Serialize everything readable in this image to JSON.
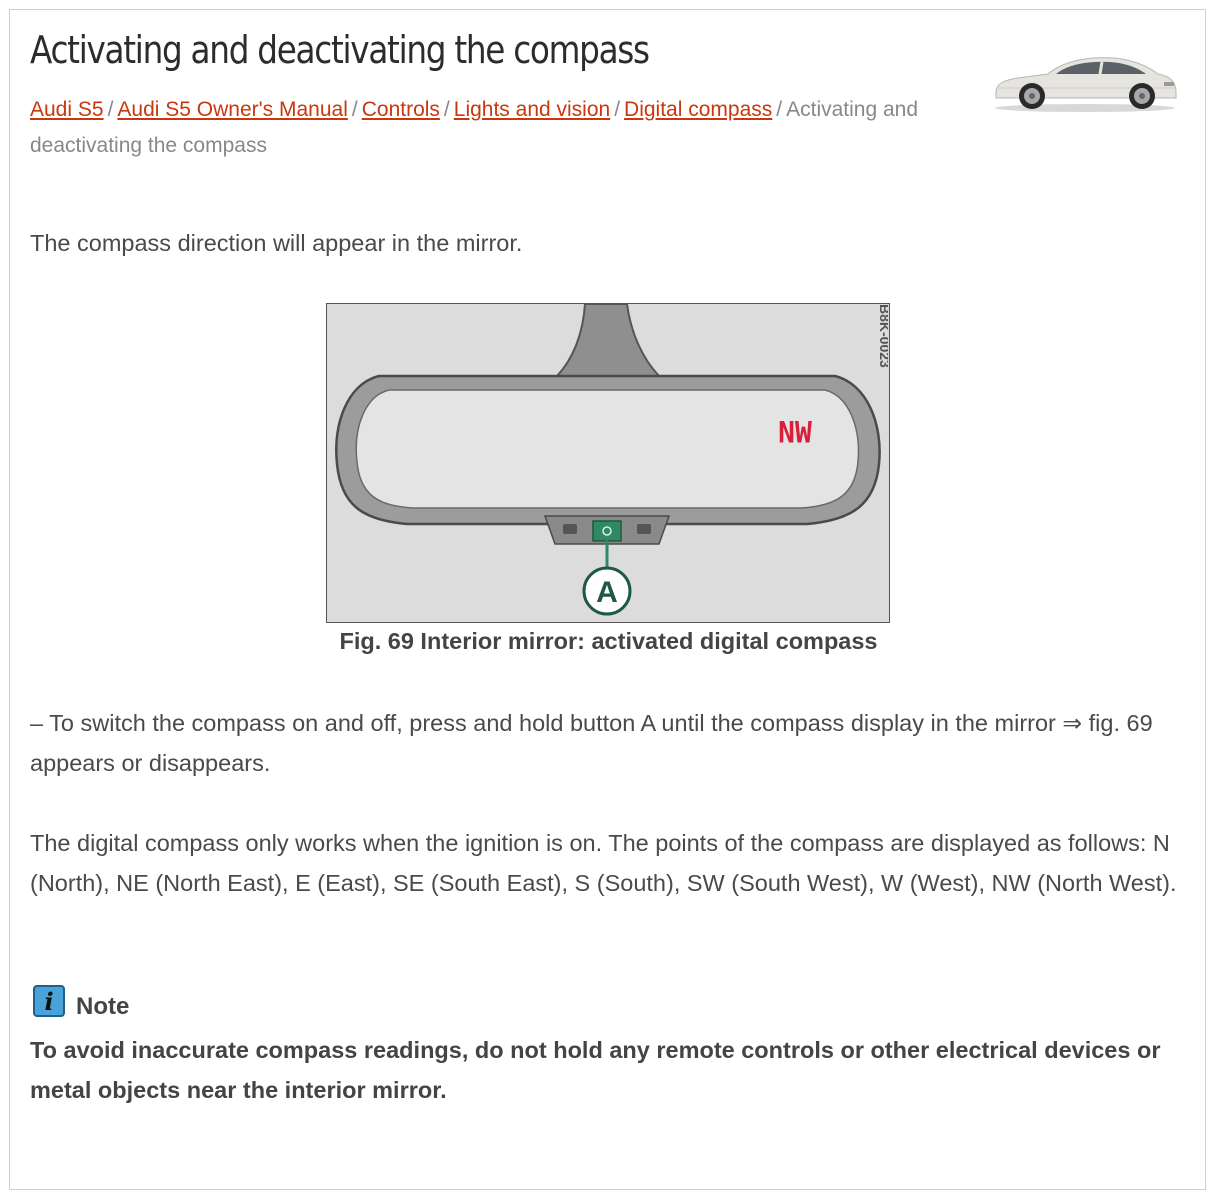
{
  "title": "Activating and deactivating the compass",
  "breadcrumb": {
    "links": [
      "Audi S5",
      "Audi S5 Owner's Manual",
      "Controls",
      "Lights and vision",
      "Digital compass"
    ],
    "current": "Activating and deactivating the compass",
    "separator": "/"
  },
  "intro": "The compass direction will appear in the mirror.",
  "figure": {
    "code": "B8K-0023",
    "compass_reading": "NW",
    "callout": "A",
    "caption": "Fig. 69 Interior mirror: activated digital compass"
  },
  "step": "– To switch the compass on and off, press and hold button A until the compass display in the mirror ⇒ fig. 69 appears or disappears.",
  "info": "The digital compass only works when the ignition is on. The points of the compass are displayed as follows: N (North), NE (North East), E (East), SE (South East), S (South), SW (South West), W (West), NW (North West).",
  "note": {
    "icon_glyph": "i",
    "title": "Note",
    "text": "To avoid inaccurate compass readings, do not hold any remote controls or other electrical devices or metal objects near the interior mirror."
  },
  "colors": {
    "link": "#c8380c",
    "compass_text": "#d81f3c",
    "button_green": "#2f8a63",
    "info_icon": "#4aa3d8"
  }
}
